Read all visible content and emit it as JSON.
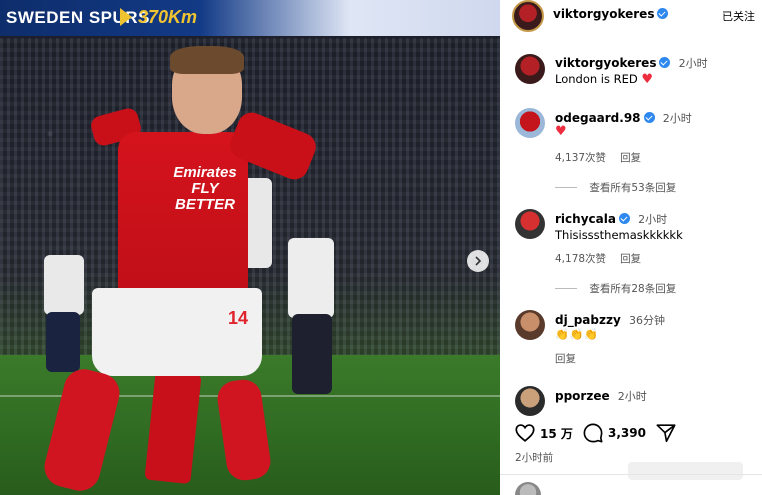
{
  "photo": {
    "ad_board": {
      "team_text": "SWEDEN SPURS",
      "value_text": "370Km"
    },
    "sponsor_text": "Emirates\nFLY BETTER",
    "shirt_number": "14"
  },
  "header": {
    "username": "viktorgyokeres",
    "follow_label": "已关注"
  },
  "caption": {
    "username": "viktorgyokeres",
    "time": "2小时",
    "text": "London is RED"
  },
  "comments": [
    {
      "username": "odegaard.98",
      "verified": true,
      "time": "2小时",
      "text": "",
      "likes": "4,137次赞",
      "reply_label": "回复",
      "view_replies": "查看所有53条回复"
    },
    {
      "username": "richycala",
      "verified": true,
      "time": "2小时",
      "text": "Thisisssthemaskkkkkk",
      "likes": "4,178次赞",
      "reply_label": "回复",
      "view_replies": "查看所有28条回复"
    },
    {
      "username": "dj_pabzzy",
      "verified": false,
      "time": "36分钟",
      "text": "👏👏👏",
      "likes": "",
      "reply_label": "回复"
    },
    {
      "username": "pporzee",
      "verified": false,
      "time": "2小时",
      "text": ""
    }
  ],
  "actions": {
    "likes_count": "15 万",
    "comments_count": "3,390"
  },
  "post_time": "2小时前",
  "icons": {
    "heart": "heart-icon",
    "comment": "comment-icon",
    "share": "send-icon",
    "verified": "verified-badge-icon",
    "next": "chevron-right-icon"
  },
  "colors": {
    "verified_blue": "#2e88f0",
    "heart_red": "#ed2d3f",
    "arsenal_red": "#d5131d"
  }
}
